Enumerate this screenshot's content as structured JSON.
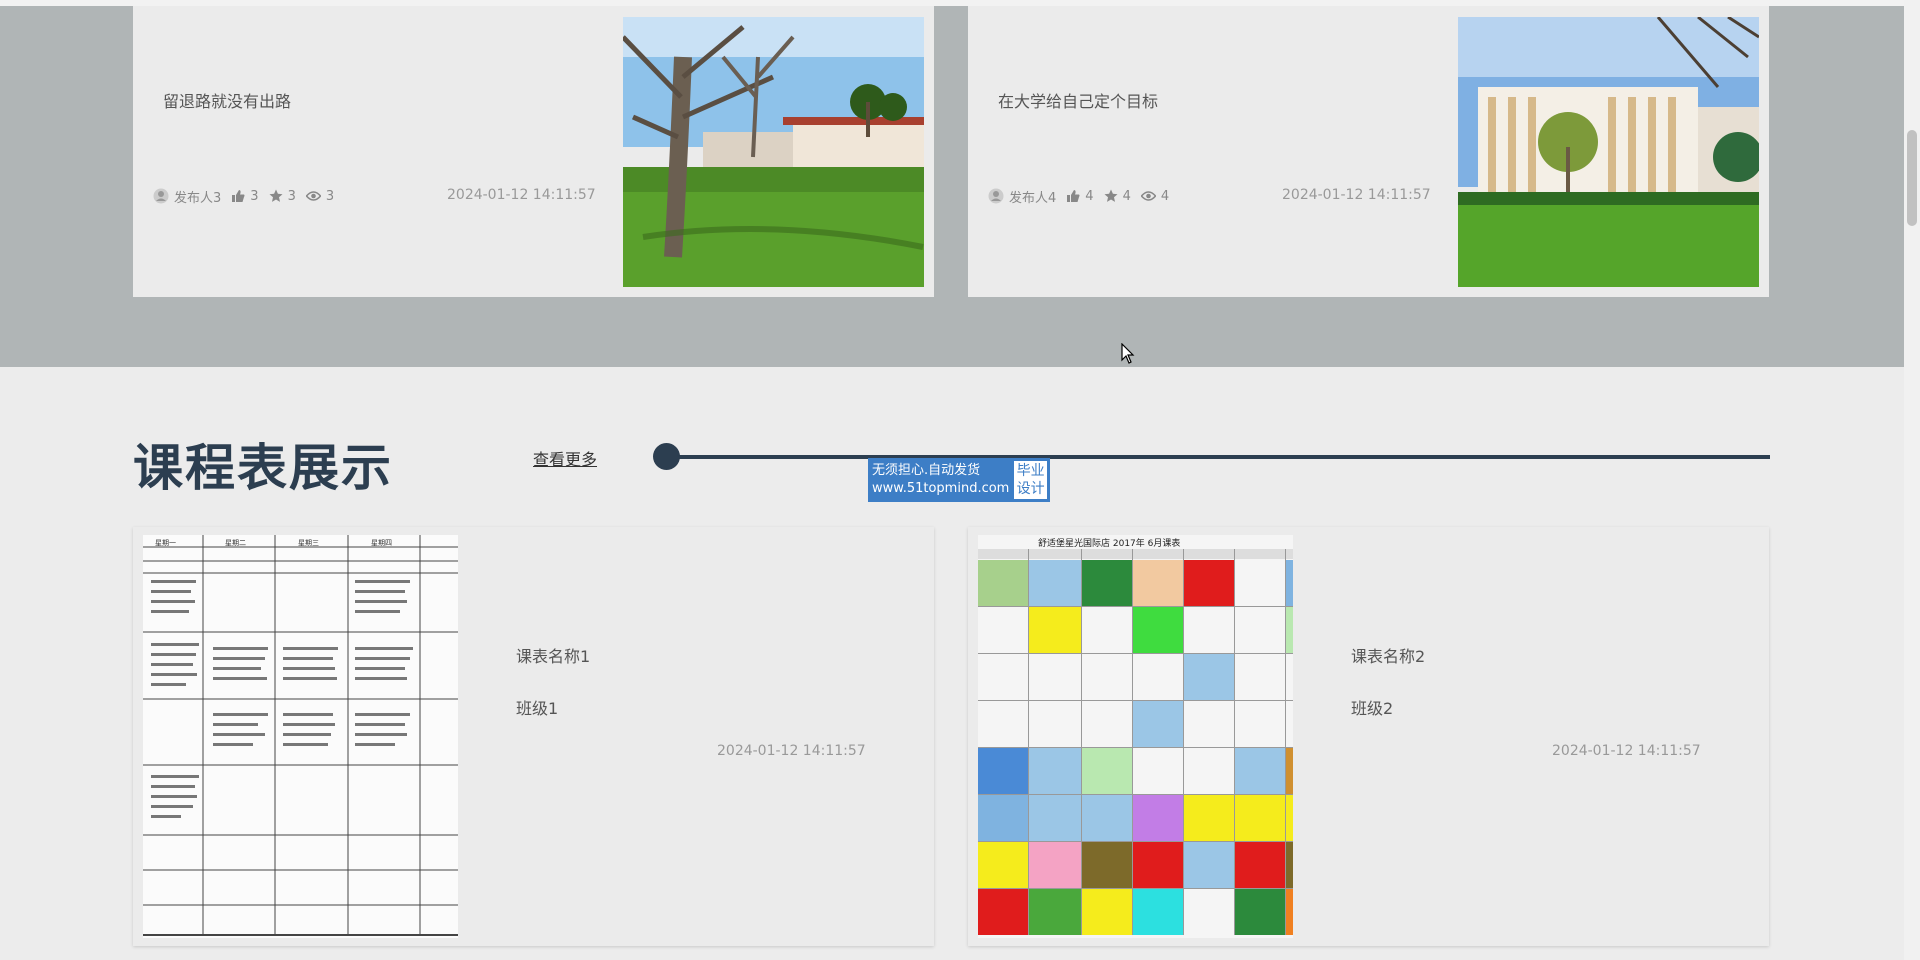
{
  "articles": [
    {
      "title": "留退路就没有出路",
      "author": "发布人3",
      "likes": "3",
      "favorites": "3",
      "views": "3",
      "date": "2024-01-12 14:11:57"
    },
    {
      "title": "在大学给自己定个目标",
      "author": "发布人4",
      "likes": "4",
      "favorites": "4",
      "views": "4",
      "date": "2024-01-12 14:11:57"
    }
  ],
  "schedule_section": {
    "title": "课程表展示",
    "more_label": "查看更多"
  },
  "watermark": {
    "line1": "无须担心.自动发货",
    "line2": "www.51topmind.com",
    "badge1": "毕业",
    "badge2": "设计"
  },
  "schedules": [
    {
      "name": "课表名称1",
      "class": "班级1",
      "date": "2024-01-12 14:11:57"
    },
    {
      "name": "课表名称2",
      "class": "班级2",
      "date": "2024-01-12 14:11:57"
    }
  ],
  "schedule_image_2_header": "舒适堡星光国际店  2017年 6月课表",
  "schedule_image_1_header": [
    "星期一",
    "星期二",
    "星期三",
    "星期四"
  ],
  "colors": {
    "accent_dark": "#2c3e50",
    "band_gray": "#b0b5b6",
    "watermark_blue": "#3d7ec6"
  }
}
